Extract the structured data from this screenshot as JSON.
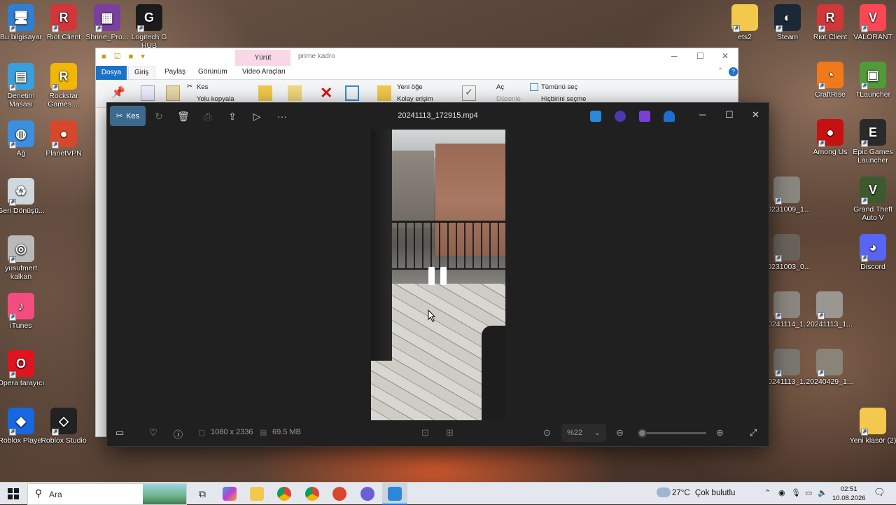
{
  "desktop": {
    "icons_left": [
      {
        "label": "Bu bilgisayar",
        "icon": "computer-icon",
        "color": "#2f7fd6"
      },
      {
        "label": "Riot Client",
        "icon": "riot-client-icon",
        "color": "#d13639"
      },
      {
        "label": "Shrine_Pro...",
        "icon": "winrar-archive-icon",
        "color": "#7b3fa0"
      },
      {
        "label": "Logitech G HUB",
        "icon": "logitech-g-icon",
        "color": "#1b1b1b"
      },
      {
        "label": "Denetim Masası",
        "icon": "control-panel-icon",
        "color": "#3aa0dd"
      },
      {
        "label": "Rockstar Games ...",
        "icon": "rockstar-icon",
        "color": "#f2b705"
      },
      {
        "label": "Ağ",
        "icon": "network-icon",
        "color": "#3b8fe0"
      },
      {
        "label": "PlanetVPN",
        "icon": "planetvpn-icon",
        "color": "#d9472b"
      },
      {
        "label": "Geri Dönüşü...",
        "icon": "recycle-bin-icon",
        "color": "#cfd8dc"
      },
      {
        "label": "yusufmert kalkan",
        "icon": "cd-icon",
        "color": "#b9b9b9"
      },
      {
        "label": "iTunes",
        "icon": "itunes-icon",
        "color": "#f44c7f"
      },
      {
        "label": "Opera tarayıcı",
        "icon": "opera-icon",
        "color": "#e0141e"
      },
      {
        "label": "Roblox Player",
        "icon": "roblox-player-icon",
        "color": "#1768e0"
      },
      {
        "label": "Roblox Studio",
        "icon": "roblox-studio-icon",
        "color": "#222222"
      }
    ],
    "icons_right": [
      {
        "label": "ets2",
        "icon": "folder-icon",
        "color": "#f2c94c"
      },
      {
        "label": "Steam",
        "icon": "steam-icon",
        "color": "#1b2838"
      },
      {
        "label": "Riot Client",
        "icon": "riot-client-icon",
        "color": "#d13639"
      },
      {
        "label": "VALORANT",
        "icon": "valorant-icon",
        "color": "#ff4655"
      },
      {
        "label": "CraftRise",
        "icon": "craftrise-icon",
        "color": "#f07a1a"
      },
      {
        "label": "TLauncher",
        "icon": "tlauncher-icon",
        "color": "#4f9b3a"
      },
      {
        "label": "Among Us",
        "icon": "among-us-icon",
        "color": "#c51111"
      },
      {
        "label": "Epic Games Launcher",
        "icon": "epic-games-icon",
        "color": "#2a2a2a"
      },
      {
        "label": "20231009_1...",
        "icon": "image-file-icon",
        "color": "#8a8680"
      },
      {
        "label": "Grand Theft Auto V",
        "icon": "gta-v-icon",
        "color": "#3c5a2e"
      },
      {
        "label": "20231003_0...",
        "icon": "image-file-icon",
        "color": "#6a625a"
      },
      {
        "label": "Discord",
        "icon": "discord-icon",
        "color": "#5865f2"
      },
      {
        "label": "20241114_1...",
        "icon": "video-file-icon",
        "color": "#8a8680"
      },
      {
        "label": "20241113_1...",
        "icon": "video-file-icon",
        "color": "#9a9690"
      },
      {
        "label": "20241113_1...",
        "icon": "video-file-icon",
        "color": "#7a7670"
      },
      {
        "label": "20240429_1...",
        "icon": "video-file-icon",
        "color": "#8a8378"
      },
      {
        "label": "Yeni klasör (2)",
        "icon": "folder-icon",
        "color": "#f2c94c"
      }
    ]
  },
  "explorer": {
    "contextual_tab": "Yürüt",
    "path": "prime kadro",
    "tabs": [
      "Dosya",
      "Giriş",
      "Paylaş",
      "Görünüm",
      "Video Araçları"
    ],
    "ribbon": {
      "cut": "Kes",
      "copy_path": "Yolu kopyala",
      "new_item": "Yeni öğe",
      "easy_access": "Kolay erişim",
      "open": "Aç",
      "edit": "Düzenle",
      "select_all": "Tümünü seç",
      "select_none": "Hiçbirini seçme"
    },
    "accent": "#1a73c6"
  },
  "viewer": {
    "cut_button": "Kes",
    "title": "20241113_172915.mp4",
    "dimensions": "1080 x 2336",
    "file_size": "69.5 MB",
    "zoom": "%22",
    "zoom_level": 0.0,
    "playback_state": "paused",
    "accent": "#3c6a8f"
  },
  "taskbar": {
    "search_placeholder": "Ara",
    "weather_temp": "27°C",
    "weather_desc": "Çok bulutlu",
    "time": "02:51",
    "date": "10.08.2026"
  }
}
